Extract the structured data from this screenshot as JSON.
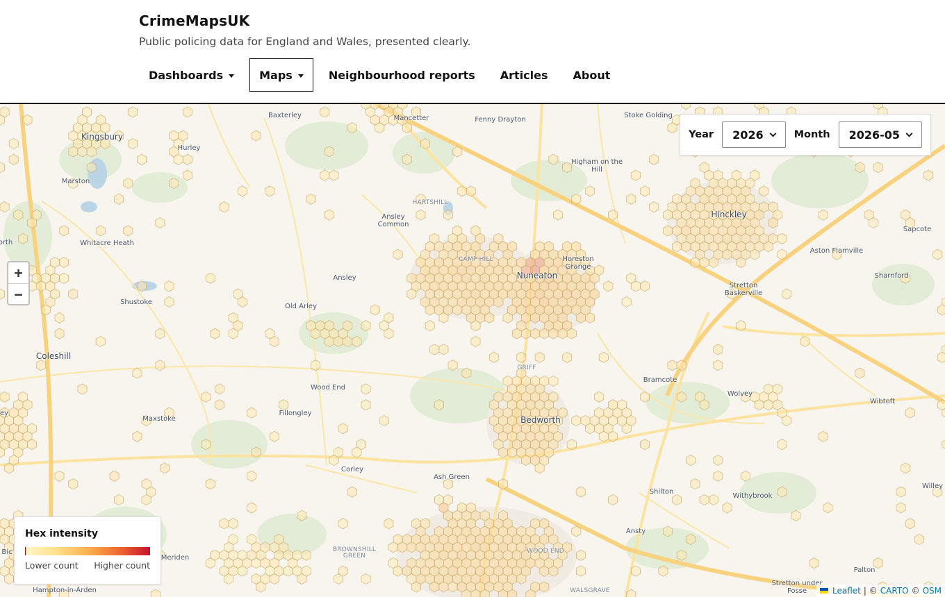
{
  "site": {
    "title": "CrimeMapsUK",
    "tagline": "Public policing data for England and Wales, presented clearly."
  },
  "nav": {
    "dashboards": "Dashboards",
    "maps": "Maps",
    "neighbourhood_reports": "Neighbourhood reports",
    "articles": "Articles",
    "about": "About"
  },
  "controls": {
    "year_label": "Year",
    "year_value": "2026",
    "month_label": "Month",
    "month_value": "2026-05"
  },
  "zoom": {
    "in": "+",
    "out": "−"
  },
  "legend": {
    "title": "Hex intensity",
    "low": "Lower count",
    "high": "Higher count"
  },
  "attribution": {
    "leaflet": "Leaflet",
    "sep": "| ©",
    "carto": "CARTO",
    "copy": "©",
    "osm": "OSM"
  },
  "places": {
    "baxterley": "Baxterley",
    "mancetter": "Mancetter",
    "fenny_drayton": "Fenny Drayton",
    "stoke_golding": "Stoke Golding",
    "kingsbury": "Kingsbury",
    "hurley": "Hurley",
    "higham_on_the_hill": "Higham on the Hill",
    "marston": "Marston",
    "hartshill": "HARTSHILL",
    "ansley_common": "Ansley Common",
    "hinckley": "Hinckley",
    "sapcote": "Sapcote",
    "north": "orth",
    "whitacre_heath": "Whitacre Heath",
    "camp_hill": "CAMP HILL",
    "horeston_grange": "Horeston Grange",
    "aston_flamville": "Aston Flamville",
    "nuneaton": "Nuneaton",
    "ansley": "Ansley",
    "sharnford": "Sharnford",
    "stretton_baskerville": "Stretton Baskerville",
    "shustoke": "Shustoke",
    "old_arley": "Old Arley",
    "coleshill": "Coleshill",
    "griff": "GRIFF",
    "bramcote": "Bramcote",
    "wood_end": "Wood End",
    "wolvey": "Wolvey",
    "wibtoft": "Wibtoft",
    "ey": "ey",
    "maxstoke": "Maxstoke",
    "fillongley": "Fillongley",
    "bedworth": "Bedworth",
    "corley": "Corley",
    "ash_green": "Ash Green",
    "willey": "Willey",
    "shilton": "Shilton",
    "withybrook": "Withybrook",
    "ansty": "Ansty",
    "brownshill_green": "BROWNSHILL GREEN",
    "wood_end_2": "WOOD END",
    "bic": "Bic",
    "meriden": "Meriden",
    "palton": "Palton",
    "hampton_in_arden": "Hampton-in-Arden",
    "walsgrave": "WALSGRAVE",
    "stretton_under_fosse": "Stretton under Fosse"
  },
  "colors": {
    "hex_low": "#fff3c4",
    "hex_mid": "#fbd08a",
    "hex_high": "#e8867e",
    "hex_stroke": "#c9a765",
    "road": "#fde7a6",
    "motorway": "#f9cf7a",
    "park": "#dfe9d2",
    "water": "#bcd5e6",
    "urban": "#efebe3"
  }
}
